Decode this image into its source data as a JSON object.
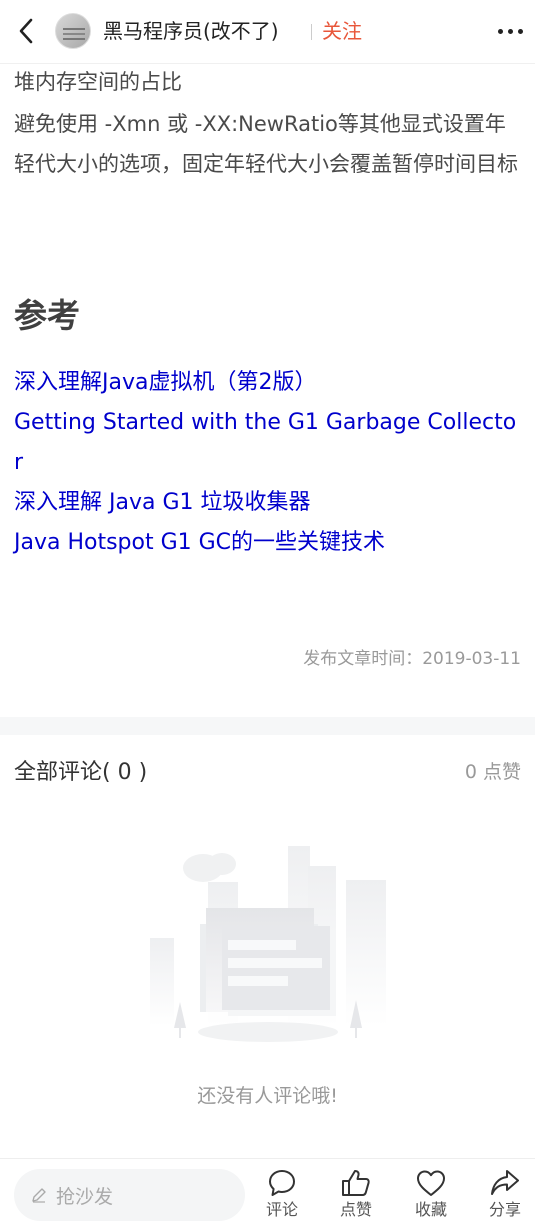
{
  "header": {
    "author_name": "黑马程序员(改不了)",
    "follow_label": "关注"
  },
  "article": {
    "paragraphs": [
      "堆内存空间的占比",
      "避免使用 -Xmn 或 -XX:NewRatio等其他显式设置年轻代大小的选项，固定年轻代大小会覆盖暂停时间目标"
    ],
    "references_heading": "参考",
    "references": [
      "深入理解Java虚拟机（第2版）",
      "Getting Started with the G1 Garbage Collector",
      "深入理解 Java G1 垃圾收集器",
      "Java Hotspot G1 GC的一些关键技术"
    ],
    "publish_time": "发布文章时间：2019-03-11"
  },
  "comments": {
    "title": "全部评论( 0 )",
    "likes": "0 点赞",
    "empty_text": "还没有人评论哦!"
  },
  "bottom_bar": {
    "input_placeholder": "抢沙发",
    "actions": [
      {
        "label": "评论",
        "icon": "comment-icon"
      },
      {
        "label": "点赞",
        "icon": "thumbs-up-icon"
      },
      {
        "label": "收藏",
        "icon": "heart-icon"
      },
      {
        "label": "分享",
        "icon": "share-icon"
      }
    ]
  }
}
